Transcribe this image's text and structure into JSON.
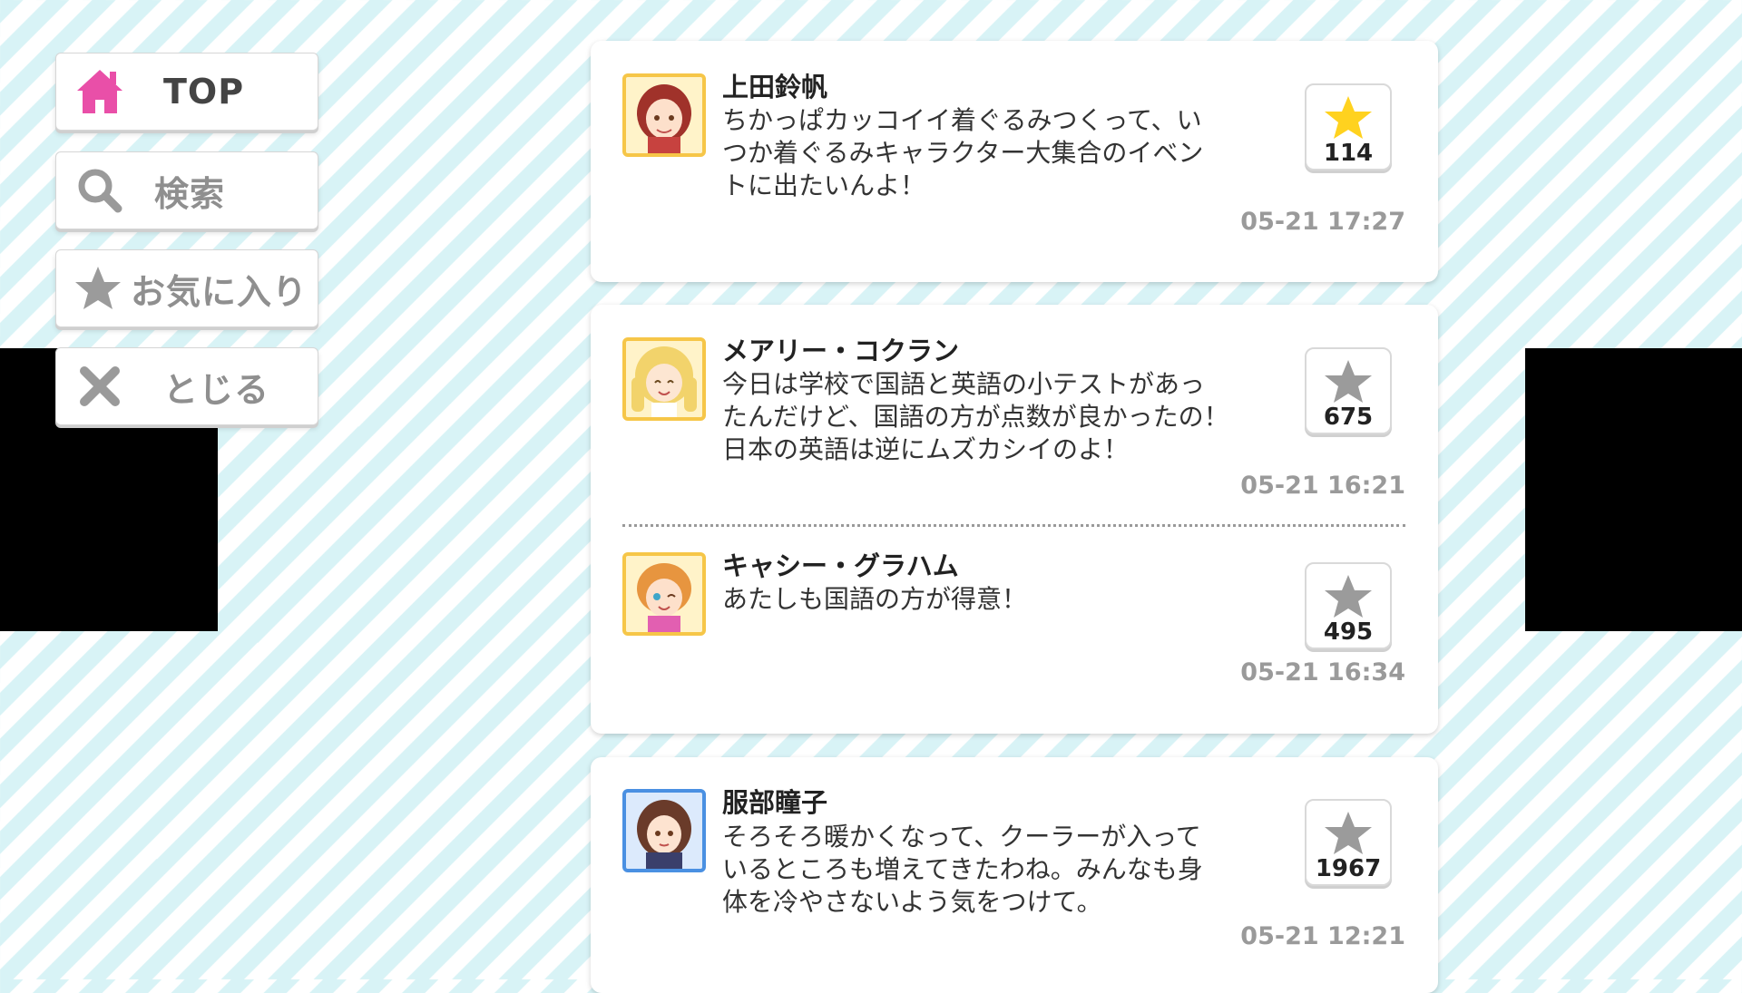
{
  "menu": {
    "top_label": "TOP",
    "search_label": "検索",
    "favorites_label": "お気に入り",
    "close_label": "とじる"
  },
  "colors": {
    "home_icon": "#e94fa8",
    "star_active": "#ffd21f",
    "star_inactive": "#9b9b9b",
    "gray_text": "#9a9a9a"
  },
  "posts": [
    {
      "name": "上田鈴帆",
      "message": "ちかっぱカッコイイ着ぐるみつくって、い\nつか着ぐるみキャラクター大集合のイベン\nトに出たいんよ！",
      "fav_count": "114",
      "favorited": true,
      "time": "05-21 17:27"
    },
    {
      "name": "メアリー・コクラン",
      "message": "今日は学校で国語と英語の小テストがあっ\nたんだけど、国語の方が点数が良かったの！\n日本の英語は逆にムズカシイのよ！",
      "fav_count": "675",
      "favorited": false,
      "time": "05-21 16:21"
    },
    {
      "name": "キャシー・グラハム",
      "message": "あたしも国語の方が得意！",
      "fav_count": "495",
      "favorited": false,
      "time": "05-21 16:34"
    },
    {
      "name": "服部瞳子",
      "message": "そろそろ暖かくなって、クーラーが入って\nいるところも増えてきたわね。みんなも身\n体を冷やさないよう気をつけて。",
      "fav_count": "1967",
      "favorited": false,
      "time": "05-21 12:21"
    }
  ]
}
